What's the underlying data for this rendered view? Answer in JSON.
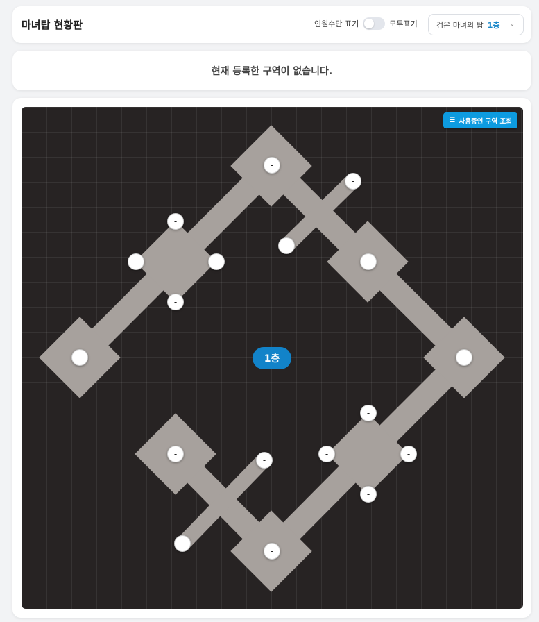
{
  "header": {
    "title": "마녀탑 현황판",
    "toggle_left_label": "인원수만 표기",
    "toggle_right_label": "모두표기",
    "tower_name": "검은 마녀의 탑",
    "selected_floor": "1층"
  },
  "notice": {
    "text": "현재 등록한 구역이 없습니다."
  },
  "map": {
    "zones_button_label": "사용중인 구역 조회",
    "floor_label": "1층",
    "colors": {
      "background": "#272323",
      "path": "#a7a19d",
      "accent": "#0d9be0"
    },
    "nodes": [
      {
        "id": "top",
        "label": "-"
      },
      {
        "id": "top-branch-upper",
        "label": "-"
      },
      {
        "id": "top-branch-lower",
        "label": "-"
      },
      {
        "id": "left-room-top",
        "label": "-"
      },
      {
        "id": "left-room-left",
        "label": "-"
      },
      {
        "id": "left-room-right",
        "label": "-"
      },
      {
        "id": "left-room-bottom",
        "label": "-"
      },
      {
        "id": "right-upper-room",
        "label": "-"
      },
      {
        "id": "far-left",
        "label": "-"
      },
      {
        "id": "far-right",
        "label": "-"
      },
      {
        "id": "bottom-left-room",
        "label": "-"
      },
      {
        "id": "bottom-branch-upper",
        "label": "-"
      },
      {
        "id": "bottom-branch-lower",
        "label": "-"
      },
      {
        "id": "right-lower-room-top",
        "label": "-"
      },
      {
        "id": "right-lower-room-left",
        "label": "-"
      },
      {
        "id": "right-lower-room-right",
        "label": "-"
      },
      {
        "id": "right-lower-room-bottom",
        "label": "-"
      },
      {
        "id": "bottom",
        "label": "-"
      }
    ]
  }
}
